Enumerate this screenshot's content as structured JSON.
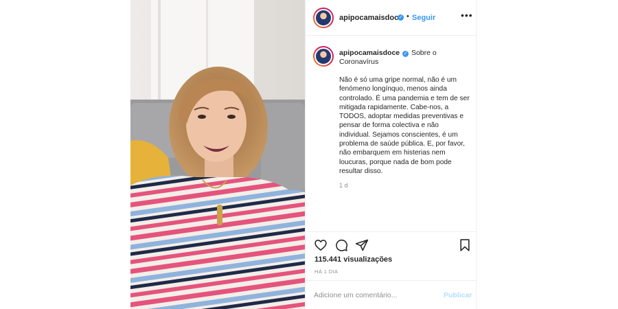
{
  "post": {
    "username": "apipocamaisdoce",
    "verified_badge": "✓",
    "dot": "•",
    "follow_label": "Seguir",
    "more_label": "•••",
    "caption_username": "apipocamaisdoce",
    "caption_title": "Sobre o Coronavírus",
    "caption_body": "Não é só uma gripe normal, não é um fenómeno longínquo, menos ainda controlado. É uma pandemia e tem de ser mitigada rapidamente. Cabe-nos, a TODOS, adoptar medidas preventivas e pensar de forma colectiva e não individual. Sejamos conscientes, é um problema de saúde pública. E, por favor, não embarquem em histerias nem loucuras, porque nada de bom pode resultar disso.",
    "caption_time": "1 d",
    "views": "115.441 visualizações",
    "posted_ago": "HÁ 1 DIA",
    "comment_placeholder": "Adicione um comentário...",
    "publish_label": "Publicar"
  },
  "icons": [
    "heart-icon",
    "comment-icon",
    "share-icon",
    "bookmark-icon"
  ],
  "colors": {
    "link": "#3897f0",
    "publish_disabled": "#b2dffc",
    "muted": "#8e8e8e",
    "border": "#efefef"
  }
}
